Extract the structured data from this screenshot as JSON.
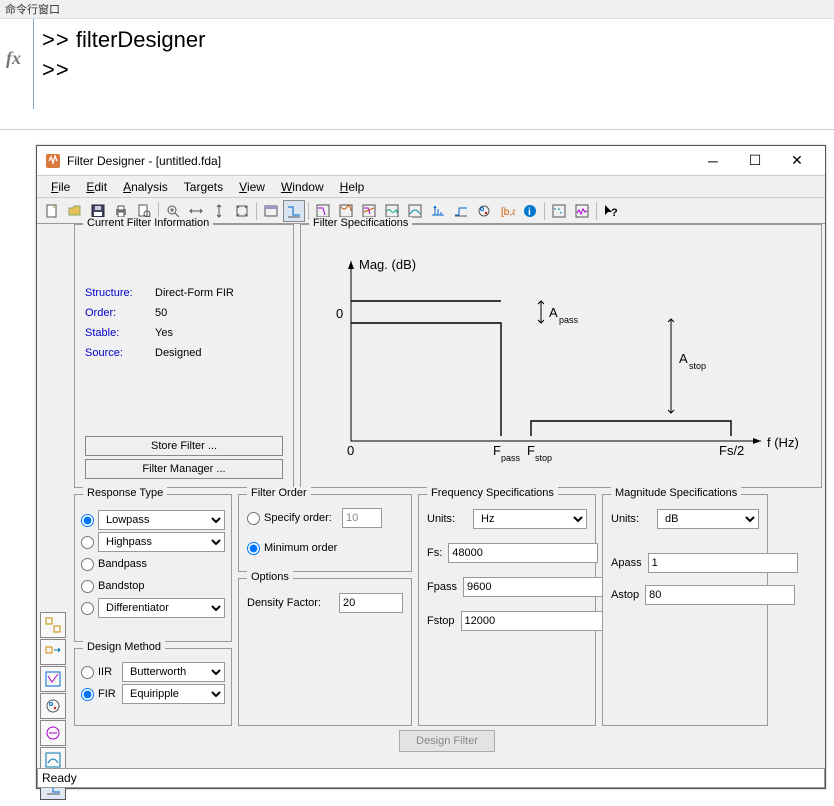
{
  "cmd": {
    "title": "命令行窗口",
    "prompt": ">>",
    "command": "filterDesigner"
  },
  "window": {
    "title": "Filter Designer - [untitled.fda]"
  },
  "menu": {
    "file": "File",
    "edit": "Edit",
    "analysis": "Analysis",
    "targets": "Targets",
    "view": "View",
    "window": "Window",
    "help": "Help"
  },
  "cfi": {
    "title": "Current Filter Information",
    "structure_lbl": "Structure:",
    "structure_val": "Direct-Form FIR",
    "order_lbl": "Order:",
    "order_val": "50",
    "stable_lbl": "Stable:",
    "stable_val": "Yes",
    "source_lbl": "Source:",
    "source_val": "Designed",
    "store_btn": "Store Filter ...",
    "manager_btn": "Filter Manager ..."
  },
  "spec": {
    "title": "Filter Specifications",
    "mag_label": "Mag. (dB)",
    "zero": "0",
    "fpass": "F",
    "fstop": "F",
    "fs2": "Fs/2",
    "fhz": "f (Hz)",
    "apass": "A",
    "astop": "A"
  },
  "response": {
    "title": "Response Type",
    "lowpass": "Lowpass",
    "highpass": "Highpass",
    "bandpass": "Bandpass",
    "bandstop": "Bandstop",
    "differentiator": "Differentiator"
  },
  "design": {
    "title": "Design Method",
    "iir": "IIR",
    "iir_val": "Butterworth",
    "fir": "FIR",
    "fir_val": "Equiripple"
  },
  "order": {
    "title": "Filter Order",
    "specify": "Specify order:",
    "specify_val": "10",
    "minimum": "Minimum order"
  },
  "options": {
    "title": "Options",
    "density_lbl": "Density Factor:",
    "density_val": "20"
  },
  "freq": {
    "title": "Frequency Specifications",
    "units_lbl": "Units:",
    "units_val": "Hz",
    "fs_lbl": "Fs:",
    "fs_val": "48000",
    "fpass_lbl": "Fpass",
    "fpass_val": "9600",
    "fstop_lbl": "Fstop",
    "fstop_val": "12000"
  },
  "mag": {
    "title": "Magnitude Specifications",
    "units_lbl": "Units:",
    "units_val": "dB",
    "apass_lbl": "Apass",
    "apass_val": "1",
    "astop_lbl": "Astop",
    "astop_val": "80"
  },
  "design_btn": "Design Filter",
  "status": "Ready"
}
